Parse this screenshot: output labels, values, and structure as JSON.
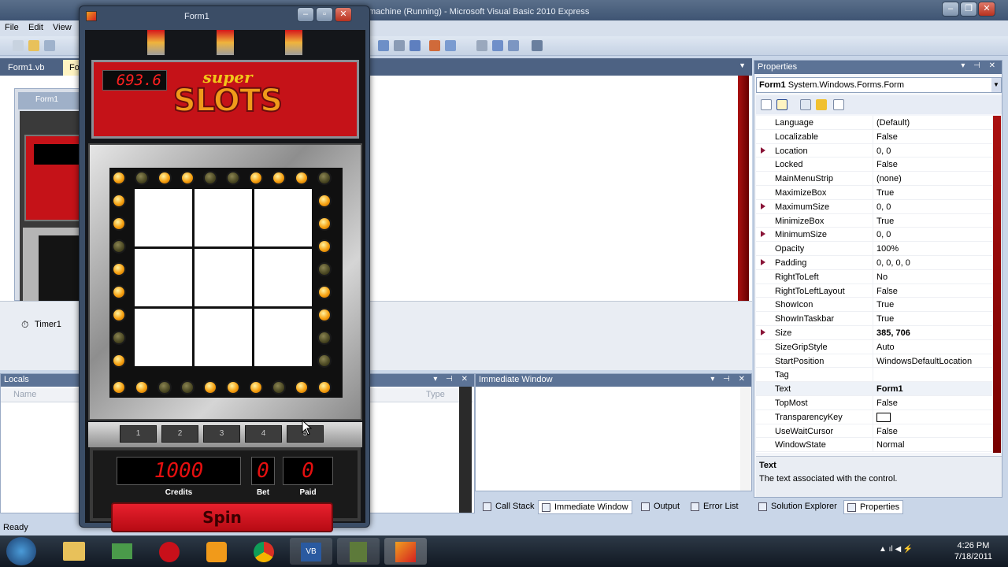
{
  "vs": {
    "title": "machine (Running) - Microsoft Visual Basic 2010 Express",
    "menu": [
      "File",
      "Edit",
      "View"
    ],
    "doc_tabs": [
      "Form1.vb",
      "Fo"
    ],
    "designer_form_title": "Form1",
    "component_tray_item": "Timer1",
    "locals_title": "Locals",
    "locals_columns": {
      "name": "Name",
      "type": "Type"
    },
    "immediate_title": "Immediate Window",
    "bottom_tabs": [
      "Call Stack",
      "Immediate Window",
      "Output",
      "Error List"
    ],
    "status": "Ready"
  },
  "properties": {
    "title": "Properties",
    "object": "Form1",
    "object_type": "System.Windows.Forms.Form",
    "rows": [
      {
        "name": "Language",
        "value": "(Default)"
      },
      {
        "name": "Localizable",
        "value": "False"
      },
      {
        "name": "Location",
        "value": "0, 0"
      },
      {
        "name": "Locked",
        "value": "False"
      },
      {
        "name": "MainMenuStrip",
        "value": "(none)"
      },
      {
        "name": "MaximizeBox",
        "value": "True"
      },
      {
        "name": "MaximumSize",
        "value": "0, 0"
      },
      {
        "name": "MinimizeBox",
        "value": "True"
      },
      {
        "name": "MinimumSize",
        "value": "0, 0"
      },
      {
        "name": "Opacity",
        "value": "100%"
      },
      {
        "name": "Padding",
        "value": "0, 0, 0, 0"
      },
      {
        "name": "RightToLeft",
        "value": "No"
      },
      {
        "name": "RightToLeftLayout",
        "value": "False"
      },
      {
        "name": "ShowIcon",
        "value": "True"
      },
      {
        "name": "ShowInTaskbar",
        "value": "True"
      },
      {
        "name": "Size",
        "value": "385, 706"
      },
      {
        "name": "SizeGripStyle",
        "value": "Auto"
      },
      {
        "name": "StartPosition",
        "value": "WindowsDefaultLocation"
      },
      {
        "name": "Tag",
        "value": ""
      },
      {
        "name": "Text",
        "value": "Form1"
      },
      {
        "name": "TopMost",
        "value": "False"
      },
      {
        "name": "TransparencyKey",
        "value": ""
      },
      {
        "name": "UseWaitCursor",
        "value": "False"
      },
      {
        "name": "WindowState",
        "value": "Normal"
      }
    ],
    "desc_title": "Text",
    "desc_text": "The text associated with the control.",
    "tabs": [
      "Solution Explorer",
      "Properties"
    ]
  },
  "form1": {
    "title": "Form1",
    "credit_display": "693.6",
    "logo_small": "super",
    "logo_big": "SLOTS",
    "line_buttons": [
      "1",
      "2",
      "3",
      "4",
      "5"
    ],
    "credits": "1000",
    "credits_label": "Credits",
    "bet": "0",
    "bet_label": "Bet",
    "paid": "0",
    "paid_label": "Paid",
    "spin_label": "Spin",
    "bulbs_top": [
      1,
      0,
      1,
      1,
      0,
      0,
      1,
      1,
      1,
      0
    ],
    "bulbs_bottom": [
      1,
      1,
      0,
      0,
      1,
      1,
      1,
      0,
      1,
      1
    ],
    "bulbs_left": [
      1,
      1,
      0,
      1,
      1,
      1,
      0,
      1
    ],
    "bulbs_right": [
      1,
      1,
      1,
      0,
      1,
      1,
      0,
      0
    ]
  },
  "taskbar": {
    "time": "4:26 PM",
    "date": "7/18/2011"
  }
}
